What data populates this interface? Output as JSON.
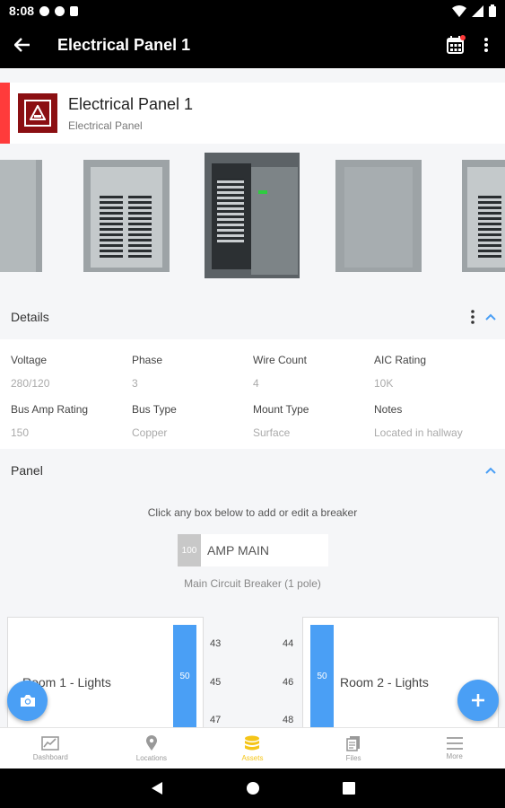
{
  "status_bar": {
    "time": "8:08"
  },
  "app_bar": {
    "title": "Electrical Panel 1"
  },
  "asset": {
    "title": "Electrical Panel 1",
    "subtitle": "Electrical Panel",
    "accent_color": "#ff3b3b",
    "logo_color": "#8b0f12"
  },
  "details_section": {
    "title": "Details",
    "fields": [
      {
        "label": "Voltage",
        "value": "280/120"
      },
      {
        "label": "Phase",
        "value": "3"
      },
      {
        "label": "Wire Count",
        "value": "4"
      },
      {
        "label": "AIC Rating",
        "value": "10K"
      },
      {
        "label": "Bus Amp Rating",
        "value": "150"
      },
      {
        "label": "Bus Type",
        "value": "Copper"
      },
      {
        "label": "Mount Type",
        "value": "Surface"
      },
      {
        "label": "Notes",
        "value": "Located in hallway"
      }
    ]
  },
  "panel_section": {
    "title": "Panel",
    "instruction": "Click any box below to add or edit a breaker",
    "main_breaker": {
      "amp": "100",
      "label": "AMP MAIN",
      "caption": "Main Circuit Breaker (1 pole)"
    },
    "left_breaker": {
      "label": "Room 1 - Lights",
      "amp": "50"
    },
    "right_breaker": {
      "label": "Room 2 - Lights",
      "amp": "50"
    },
    "left_circuits": [
      "43",
      "45",
      "47"
    ],
    "right_circuits": [
      "44",
      "46",
      "48"
    ]
  },
  "bottom_nav": {
    "items": [
      {
        "label": "Dashboard",
        "icon": "chart-icon"
      },
      {
        "label": "Locations",
        "icon": "location-pin-icon"
      },
      {
        "label": "Assets",
        "icon": "database-icon"
      },
      {
        "label": "Files",
        "icon": "files-icon"
      },
      {
        "label": "More",
        "icon": "menu-icon"
      }
    ],
    "active_index": 2,
    "active_color": "#f5c518"
  },
  "colors": {
    "primary_blue": "#4a9ff5"
  }
}
